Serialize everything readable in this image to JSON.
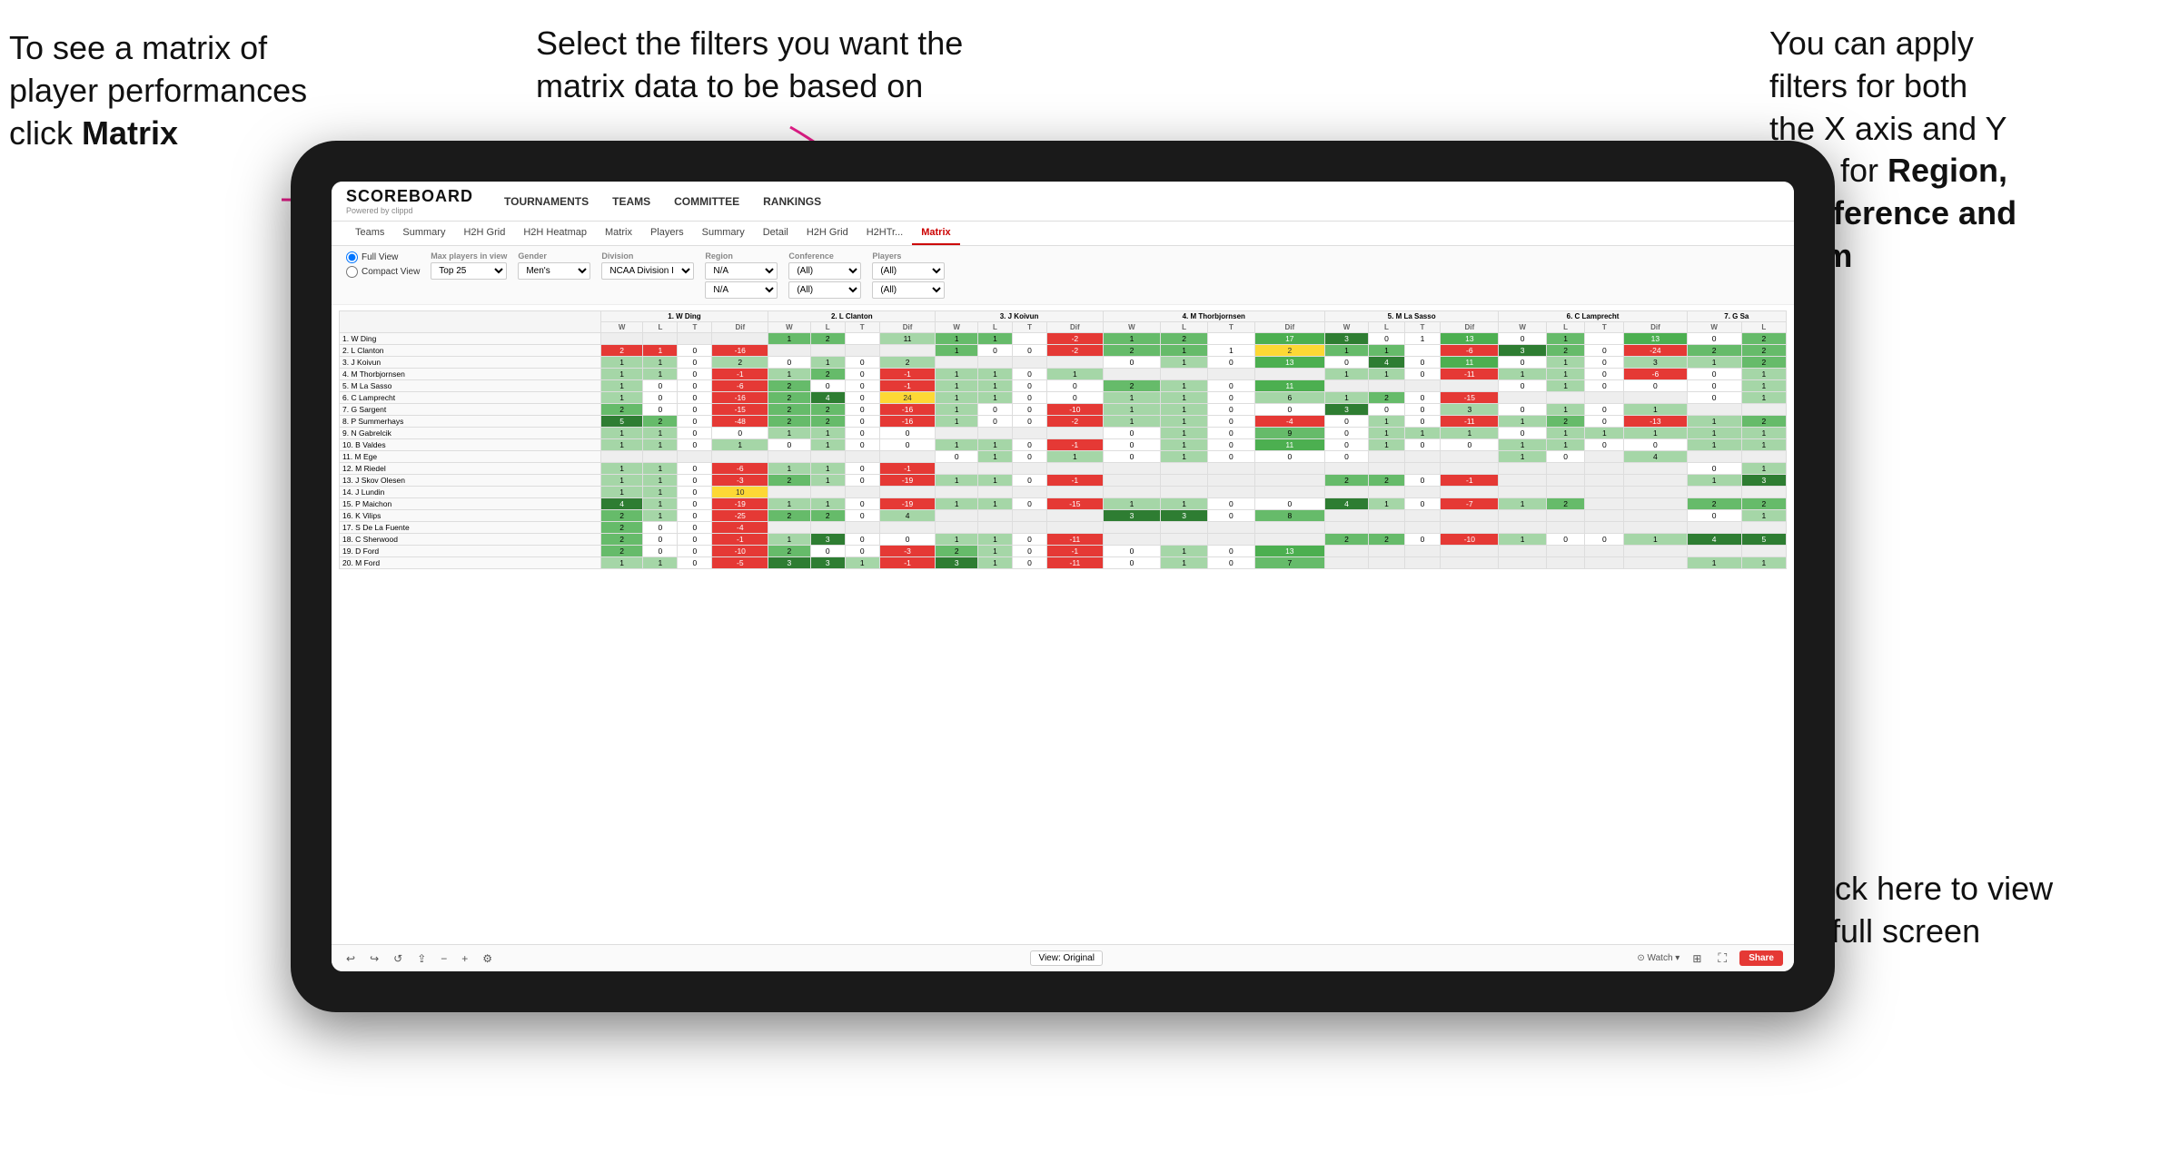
{
  "annotations": {
    "topleft": {
      "line1": "To see a matrix of",
      "line2": "player performances",
      "line3_pre": "click ",
      "line3_bold": "Matrix"
    },
    "topcenter": {
      "text": "Select the filters you want the matrix data to be based on"
    },
    "topright": {
      "line1": "You  can apply",
      "line2": "filters for both",
      "line3": "the X axis and Y",
      "line4_pre": "Axis for ",
      "line4_bold": "Region,",
      "line5_bold": "Conference and",
      "line6_bold": "Team"
    },
    "bottomright": {
      "line1": "Click here to view",
      "line2": "in full screen"
    }
  },
  "header": {
    "logo_title": "SCOREBOARD",
    "logo_sub": "Powered by clippd",
    "nav": [
      "TOURNAMENTS",
      "TEAMS",
      "COMMITTEE",
      "RANKINGS"
    ]
  },
  "sub_nav": {
    "items": [
      "Teams",
      "Summary",
      "H2H Grid",
      "H2H Heatmap",
      "Matrix",
      "Players",
      "Summary",
      "Detail",
      "H2H Grid",
      "H2HTr...",
      "Matrix"
    ],
    "active_index": 10
  },
  "filters": {
    "view_options": [
      "Full View",
      "Compact View"
    ],
    "selected_view": "Full View",
    "max_players_label": "Max players in view",
    "max_players_value": "Top 25",
    "gender_label": "Gender",
    "gender_value": "Men's",
    "division_label": "Division",
    "division_value": "NCAA Division I",
    "region_label": "Region",
    "region_value": "N/A",
    "region_value2": "N/A",
    "conference_label": "Conference",
    "conference_value": "(All)",
    "conference_value2": "(All)",
    "players_label": "Players",
    "players_value": "(All)",
    "players_value2": "(All)"
  },
  "matrix": {
    "col_headers": [
      {
        "num": "1",
        "name": "W Ding",
        "sub": [
          "W",
          "L",
          "T",
          "Dif"
        ]
      },
      {
        "num": "2",
        "name": "L Clanton",
        "sub": [
          "W",
          "L",
          "T",
          "Dif"
        ]
      },
      {
        "num": "3",
        "name": "J Koivun",
        "sub": [
          "W",
          "L",
          "T",
          "Dif"
        ]
      },
      {
        "num": "4",
        "name": "M Thorbjornsen",
        "sub": [
          "W",
          "L",
          "T",
          "Dif"
        ]
      },
      {
        "num": "5",
        "name": "M La Sasso",
        "sub": [
          "W",
          "L",
          "T",
          "Dif"
        ]
      },
      {
        "num": "6",
        "name": "C Lamprecht",
        "sub": [
          "W",
          "L",
          "T",
          "Dif"
        ]
      },
      {
        "num": "7",
        "name": "G Sa"
      }
    ],
    "rows": [
      {
        "name": "1. W Ding",
        "cells": [
          "gray",
          "gray",
          "gray",
          "gray",
          "g2",
          "g2",
          "g1",
          "y11",
          "g2",
          "g2",
          "g1",
          "y11",
          "g2",
          "g1",
          "g1",
          "g17",
          "g3",
          "g1",
          "g1",
          "g0",
          "g3",
          "g1",
          "g1",
          "g13",
          "g3",
          "g2"
        ]
      },
      {
        "name": "2. L Clanton",
        "cells": [
          "r2",
          "r1",
          "r0",
          "r-16",
          "gray",
          "gray",
          "gray",
          "gray",
          "g1",
          "r0",
          "g0",
          "r-2",
          "g2",
          "g1",
          "g1",
          "y2",
          "g1",
          "g1",
          "g1",
          "r-6",
          "g3",
          "g2",
          "g0",
          "-24",
          "g2",
          "g2"
        ]
      },
      {
        "name": "3. J Koivun",
        "cells": [
          "r1",
          "r1",
          "g0",
          "r2",
          "g0",
          "g1",
          "g0",
          "r2",
          "gray",
          "gray",
          "gray",
          "gray",
          "g0",
          "g1",
          "g0",
          "y13",
          "g0",
          "g4",
          "g0",
          "y11",
          "g0",
          "g1",
          "g0",
          "g3",
          "g1",
          "g2"
        ]
      },
      {
        "name": "4. M Thorbjornsen",
        "cells": [
          "g1",
          "r1",
          "g0",
          "r1",
          "r1",
          "r2",
          "g0",
          "r1",
          "g1",
          "g1",
          "g0",
          "g1",
          "gray",
          "gray",
          "gray",
          "gray",
          "g1",
          "g1",
          "g0",
          "r-11",
          "g1",
          "g1",
          "g0",
          "r-6",
          "g0",
          "g1"
        ]
      },
      {
        "name": "5. M La Sasso",
        "cells": [
          "r1",
          "g1",
          "g0",
          "r6",
          "g2",
          "g0",
          "g0",
          "r-1",
          "g1",
          "g1",
          "g0",
          "r0",
          "g2",
          "g1",
          "g0",
          "g11",
          "gray",
          "gray",
          "gray",
          "gray",
          "g0",
          "g1",
          "g0",
          "g0",
          "g0",
          "g1"
        ]
      },
      {
        "name": "6. C Lamprecht",
        "cells": [
          "r1",
          "g0",
          "g0",
          "r-16",
          "g2",
          "g4",
          "g0",
          "y24",
          "g1",
          "g1",
          "g0",
          "g0",
          "g1",
          "g1",
          "g0",
          "g6",
          "g1",
          "g2",
          "g0",
          "r-15",
          "gray",
          "gray",
          "gray",
          "gray",
          "g0",
          "g1"
        ]
      },
      {
        "name": "7. G Sargent",
        "cells": [
          "g2",
          "g0",
          "g0",
          "r-15",
          "g2",
          "g2",
          "g0",
          "r-16",
          "g1",
          "g0",
          "g0",
          "r-10",
          "g1",
          "g1",
          "g0",
          "g0",
          "g3",
          "g0",
          "g0",
          "g3",
          "g0",
          "g1",
          "g0",
          "g1",
          "gray",
          "gray"
        ]
      },
      {
        "name": "8. P Summerhays",
        "cells": [
          "g5",
          "r2",
          "g0",
          "r-48",
          "g2",
          "g2",
          "g0",
          "r-16",
          "g1",
          "g0",
          "g0",
          "r-2",
          "g1",
          "g1",
          "g0",
          "r-4",
          "g0",
          "g1",
          "g0",
          "r-11",
          "g1",
          "g2",
          "g0",
          "r-13",
          "g1",
          "g2"
        ]
      },
      {
        "name": "9. N Gabrelcik",
        "cells": [
          "g1",
          "g1",
          "g0",
          "g0",
          "g1",
          "g1",
          "g0",
          "g0",
          "gray",
          "gray",
          "gray",
          "gray",
          "g0",
          "g1",
          "g0",
          "g9",
          "g0",
          "g1",
          "g1",
          "g1",
          "g0",
          "g1",
          "g1",
          "g1",
          "g1",
          "g1"
        ]
      },
      {
        "name": "10. B Valdes",
        "cells": [
          "g1",
          "g1",
          "g0",
          "g1",
          "g0",
          "g1",
          "g0",
          "g0",
          "g1",
          "g1",
          "g0",
          "r-1",
          "g0",
          "g1",
          "g0",
          "g11",
          "g0",
          "g1",
          "g0",
          "g0",
          "g1",
          "g1",
          "g0",
          "g0",
          "g1",
          "g1"
        ]
      },
      {
        "name": "11. M Ege",
        "cells": [
          "gray",
          "gray",
          "gray",
          "gray",
          "gray",
          "gray",
          "gray",
          "gray",
          "g0",
          "g1",
          "g0",
          "g1",
          "g0",
          "g1",
          "g0",
          "g0",
          "g0",
          "gray",
          "gray",
          "gray",
          "g1",
          "g0",
          "gray",
          "g4",
          "gray",
          "gray"
        ]
      },
      {
        "name": "12. M Riedel",
        "cells": [
          "g1",
          "g1",
          "g0",
          "r6",
          "g1",
          "g1",
          "g0",
          "r1",
          "gray",
          "gray",
          "gray",
          "gray",
          "gray",
          "gray",
          "gray",
          "gray",
          "gray",
          "gray",
          "gray",
          "gray",
          "gray",
          "gray",
          "gray",
          "gray",
          "g0",
          "g1"
        ]
      },
      {
        "name": "13. J Skov Olesen",
        "cells": [
          "g1",
          "g1",
          "g0",
          "r3",
          "g2",
          "g1",
          "g0",
          "r-19",
          "g1",
          "g1",
          "g0",
          "r-1",
          "gray",
          "gray",
          "gray",
          "gray",
          "g2",
          "g2",
          "g0",
          "r-1",
          "gray",
          "gray",
          "gray",
          "gray",
          "g1",
          "g3"
        ]
      },
      {
        "name": "14. J Lundin",
        "cells": [
          "g1",
          "g1",
          "g0",
          "y10",
          "gray",
          "gray",
          "gray",
          "gray",
          "gray",
          "gray",
          "gray",
          "gray",
          "gray",
          "gray",
          "gray",
          "gray",
          "gray",
          "gray",
          "gray",
          "gray",
          "gray",
          "gray",
          "gray",
          "gray",
          "gray",
          "gray"
        ]
      },
      {
        "name": "15. P Maichon",
        "cells": [
          "g4",
          "g1",
          "g0",
          "r-19",
          "g1",
          "g1",
          "g0",
          "r-19",
          "g1",
          "g1",
          "g0",
          "r-15",
          "g1",
          "g1",
          "g0",
          "r-0",
          "g4",
          "g1",
          "g0",
          "r-7",
          "g1",
          "g2",
          "gray",
          "gray",
          "g2",
          "g2"
        ]
      },
      {
        "name": "16. K Vilips",
        "cells": [
          "g2",
          "g1",
          "g0",
          "r-25",
          "g2",
          "g2",
          "g0",
          "g4",
          "gray",
          "gray",
          "gray",
          "gray",
          "g3",
          "g3",
          "g0",
          "g8",
          "gray",
          "gray",
          "gray",
          "gray",
          "gray",
          "gray",
          "gray",
          "gray",
          "g0",
          "g1"
        ]
      },
      {
        "name": "17. S De La Fuente",
        "cells": [
          "g2",
          "g0",
          "g0",
          "r-4",
          "gray",
          "gray",
          "gray",
          "gray",
          "gray",
          "gray",
          "gray",
          "gray",
          "gray",
          "gray",
          "gray",
          "gray",
          "gray",
          "gray",
          "gray",
          "gray",
          "gray",
          "gray",
          "gray",
          "gray",
          "gray",
          "gray"
        ]
      },
      {
        "name": "18. C Sherwood",
        "cells": [
          "g2",
          "g0",
          "g0",
          "r-1",
          "g1",
          "g3",
          "g0",
          "g0",
          "g1",
          "g1",
          "g0",
          "r-11",
          "gray",
          "gray",
          "gray",
          "gray",
          "g2",
          "g2",
          "g0",
          "r-10",
          "g1",
          "g0",
          "g0",
          "g1",
          "g4",
          "g5"
        ]
      },
      {
        "name": "19. D Ford",
        "cells": [
          "g2",
          "g0",
          "g0",
          "r-10",
          "g2",
          "g0",
          "g0",
          "r-3",
          "g2",
          "g1",
          "g0",
          "r-1",
          "g0",
          "g1",
          "g0",
          "g13",
          "gray",
          "gray",
          "gray",
          "gray",
          "gray",
          "gray",
          "gray",
          "gray",
          "gray",
          "gray"
        ]
      },
      {
        "name": "20. M Ford",
        "cells": [
          "g1",
          "g1",
          "g0",
          "r-5",
          "g3",
          "g3",
          "g0",
          "r-1",
          "g3",
          "g1",
          "g0",
          "r-11",
          "g0",
          "g1",
          "g0",
          "g7",
          "gray",
          "gray",
          "gray",
          "gray",
          "gray",
          "gray",
          "gray",
          "gray",
          "g1",
          "g1"
        ]
      }
    ]
  },
  "toolbar": {
    "view_original": "View: Original",
    "watch": "Watch",
    "share": "Share"
  }
}
